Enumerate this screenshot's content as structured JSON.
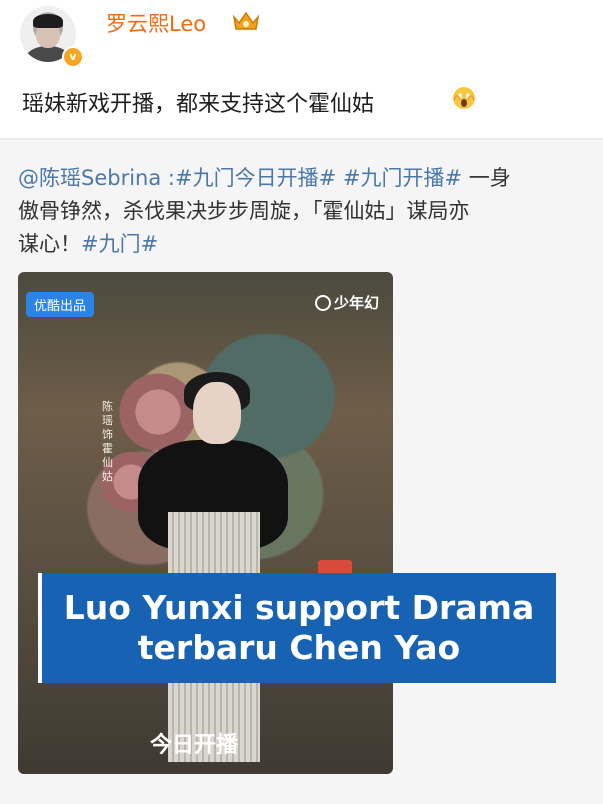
{
  "header": {
    "username": "罗云熙Leo",
    "verified_icon": "verified-badge-icon",
    "vip_icon": "vip-crown-icon"
  },
  "post": {
    "text": "瑶妹新戏开播，都来支持这个霍仙姑",
    "emoji": "screaming-face-emoji"
  },
  "repost": {
    "mention": "@陈瑶Sebrina",
    "colon": " :",
    "hashtag1": "#九门今日开播#",
    "hashtag2": "#九门开播#",
    "line1_tail": " 一身",
    "line2": "傲骨铮然，杀伐果决步步周旋，「霍仙姑」谋局亦",
    "line3_head": "谋心！",
    "hashtag3": "#九门#"
  },
  "poster": {
    "badge": "优酷出品",
    "channel": "少年幻",
    "actor_text": "陈瑶 饰 霍仙姑",
    "airdate": "今日开播"
  },
  "caption": {
    "line1": "Luo Yunxi support Drama",
    "line2": "terbaru Chen Yao"
  },
  "colors": {
    "username": "#f26a0c",
    "link": "#4a78a8",
    "caption_bg": "#1862b3"
  }
}
